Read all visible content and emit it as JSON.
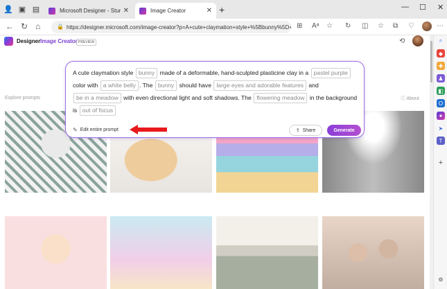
{
  "browser": {
    "tabs": [
      {
        "title": "Microsoft Designer - Stunning d",
        "active": false
      },
      {
        "title": "Image Creator",
        "active": true
      }
    ],
    "url": "https://designer.microsoft.com/image-creator?p=A+cute+claymation+style+%5Bbunny%5D+made+..."
  },
  "site": {
    "brand": "Designer",
    "app": "Image Creator",
    "badge": "PREVIEW",
    "explore_label": "Explore prompts",
    "about_label": "About"
  },
  "prompt": {
    "t1": "A cute claymation style",
    "c1": "bunny",
    "t2": "made of a deformable, hand-sculpted plasticine clay in a",
    "c2": "pastel purple",
    "t3": "color with",
    "c3": "a white belly",
    "t4": ". The",
    "c4": "bunny",
    "t5": "should have",
    "c5": "large eyes and adorable features",
    "t6": "and",
    "c6": "be in a meadow",
    "t7": "with even directional light and soft",
    "t8": "shadows. The",
    "c7": "flowering meadow",
    "t9": "in the background is",
    "c8": "out of focus"
  },
  "actions": {
    "edit_label": "Edit entire prompt",
    "share_label": "Share",
    "generate_label": "Generate"
  },
  "colors": {
    "accent": "#8a3fd8",
    "arrow": "#e8191c"
  }
}
